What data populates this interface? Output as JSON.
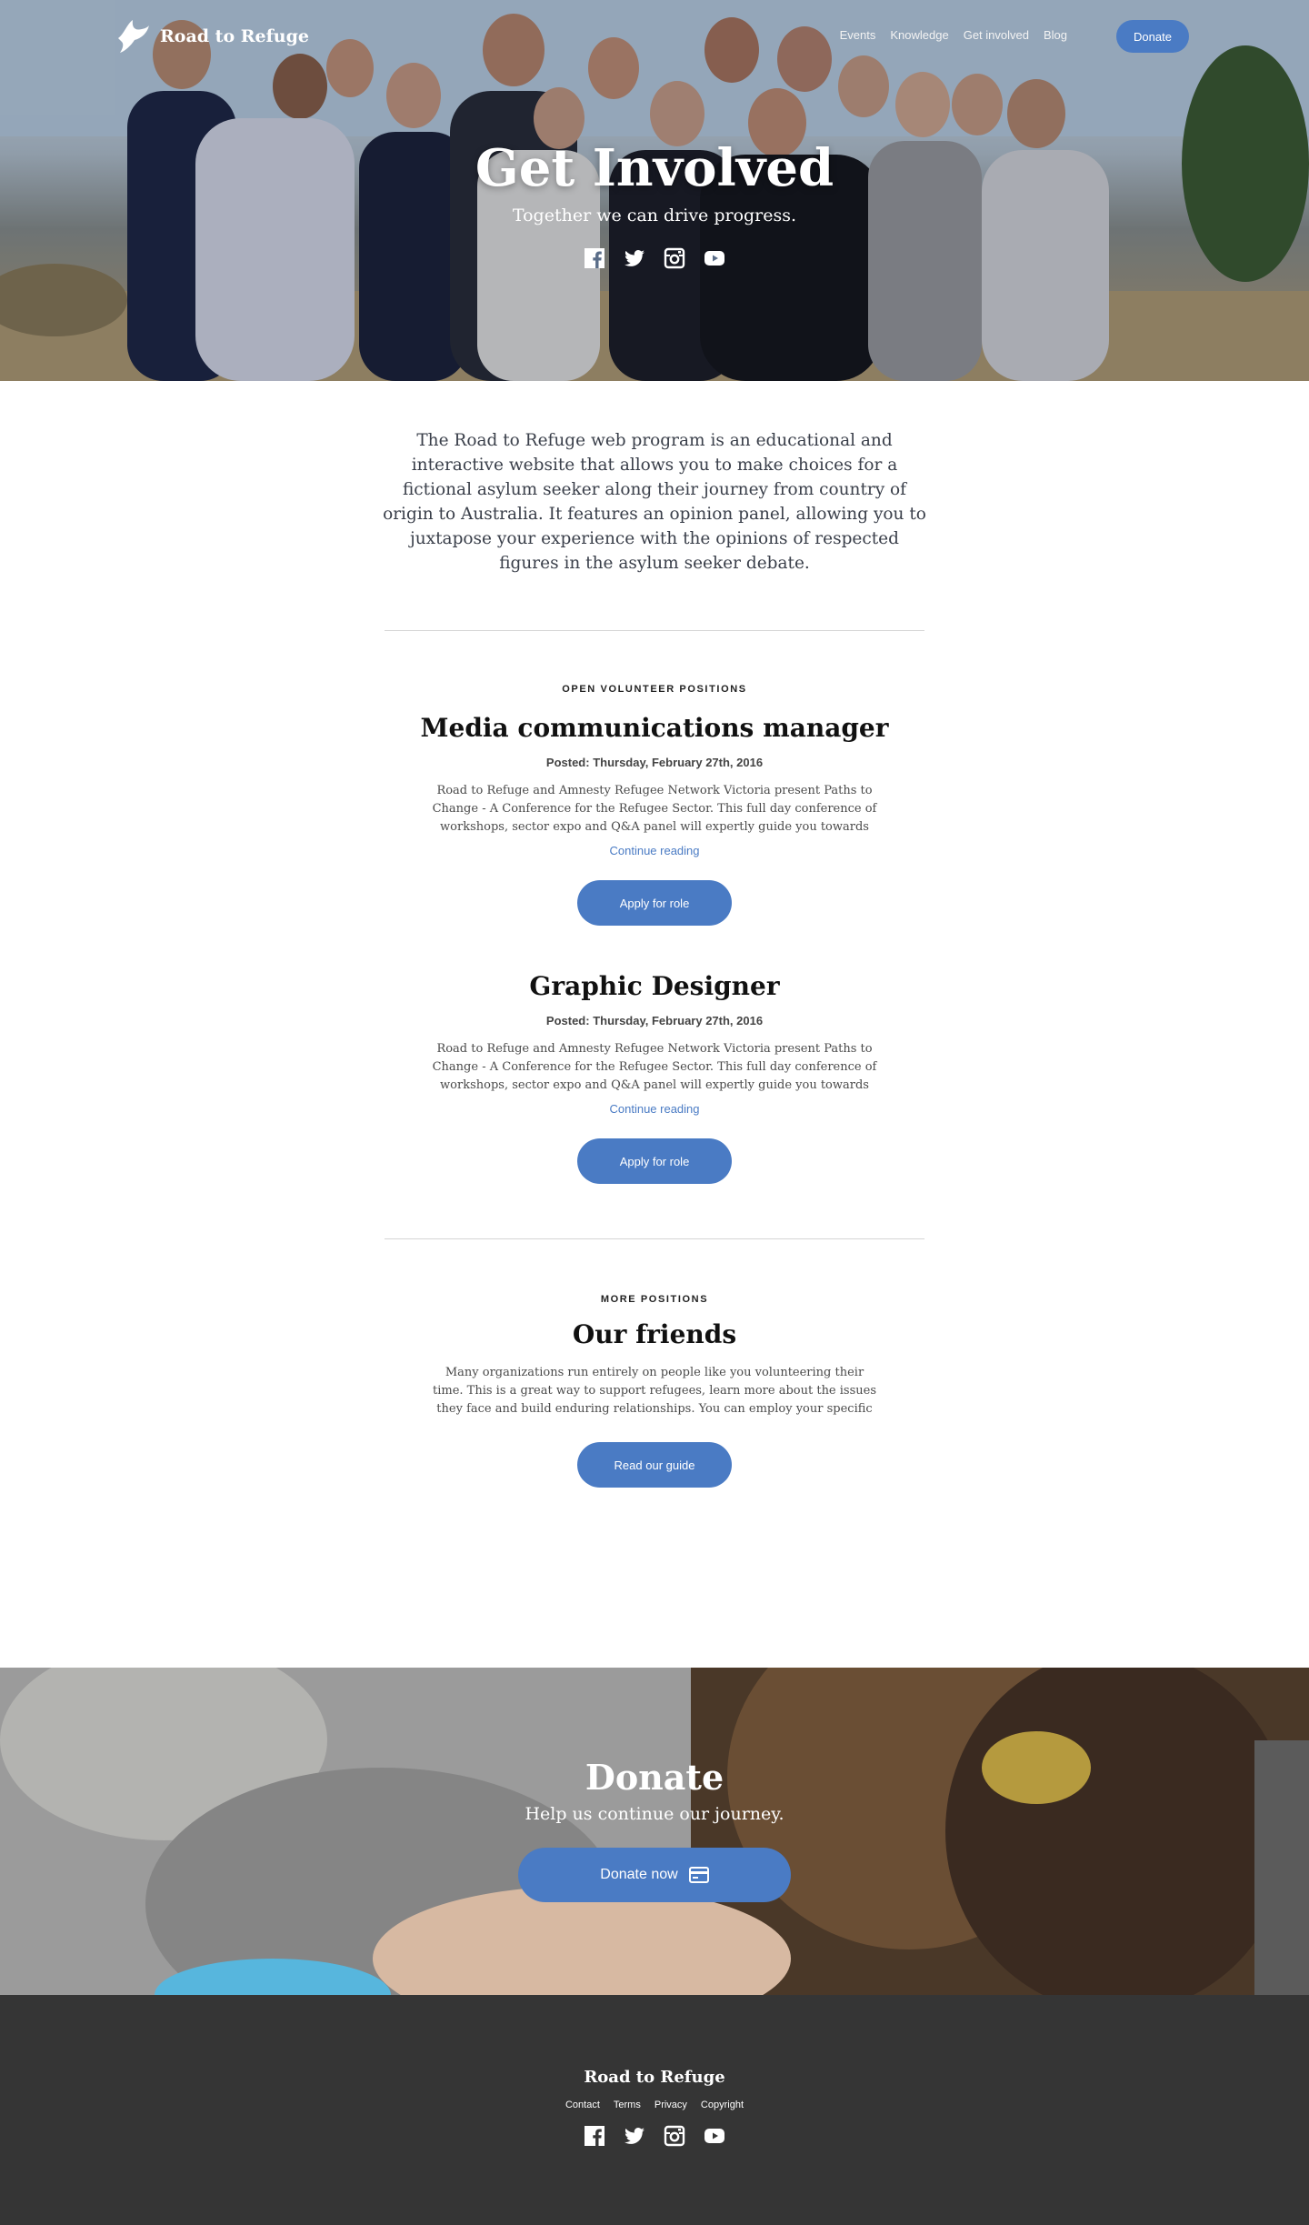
{
  "header": {
    "brand": "Road to Refuge",
    "nav": [
      {
        "label": "Events"
      },
      {
        "label": "Knowledge"
      },
      {
        "label": "Get involved"
      },
      {
        "label": "Blog"
      }
    ],
    "donate_label": "Donate"
  },
  "hero": {
    "title": "Get Involved",
    "subtitle": "Together we can drive progress.",
    "social_icons": [
      "facebook-icon",
      "twitter-icon",
      "instagram-icon",
      "youtube-icon"
    ]
  },
  "intro": {
    "text": "The Road to Refuge web program is an educational and interactive website that allows you to make choices for a fictional asylum seeker along their journey from country of origin to Australia. It features an opinion panel, allowing you to juxtapose your experience with the opinions of respected figures in the asylum seeker debate."
  },
  "positions": {
    "eyebrow": "OPEN VOLUNTEER POSITIONS",
    "jobs": [
      {
        "title": "Media communications manager",
        "posted": "Posted: Thursday, February 27th, 2016",
        "description": "Road to Refuge and Amnesty Refugee Network Victoria present Paths to Change - A Conference for the Refugee Sector. This full day conference of workshops, sector expo and Q&A panel will expertly guide you towards",
        "link": "Continue reading",
        "button": "Apply for role"
      },
      {
        "title": "Graphic Designer",
        "posted": "Posted: Thursday, February 27th, 2016",
        "description": "Road to Refuge and Amnesty Refugee Network Victoria present Paths to Change - A Conference for the Refugee Sector. This full day conference of workshops, sector expo and Q&A panel will expertly guide you towards",
        "link": "Continue reading",
        "button": "Apply for role"
      }
    ]
  },
  "friends": {
    "eyebrow": "MORE POSITIONS",
    "title": "Our friends",
    "description": "Many organizations run entirely on people like you volunteering their time. This is a great way to support refugees, learn more about the issues they face and build enduring relationships. You can employ your specific",
    "button": "Read our guide"
  },
  "donate": {
    "title": "Donate",
    "subtitle": "Help us continue our journey.",
    "button": "Donate now",
    "button_icon": "credit-card-icon"
  },
  "footer": {
    "brand": "Road to Refuge",
    "links": [
      {
        "label": "Contact"
      },
      {
        "label": "Terms"
      },
      {
        "label": "Privacy"
      },
      {
        "label": "Copyright"
      }
    ],
    "social_icons": [
      "facebook-icon",
      "twitter-icon",
      "instagram-icon",
      "youtube-icon"
    ]
  },
  "colors": {
    "accent": "#4a7bc4",
    "footer_bg": "#353535",
    "divider": "#d5d5d5"
  }
}
